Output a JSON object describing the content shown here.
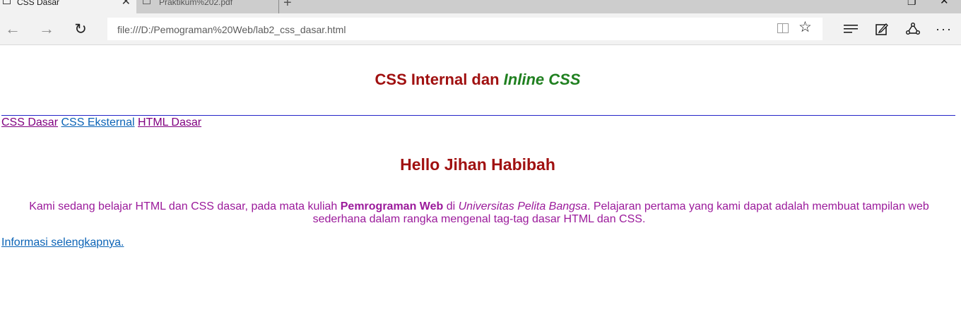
{
  "browser": {
    "tabs": [
      {
        "title": "CSS Dasar",
        "close": "✕"
      },
      {
        "title": "Praktikum%202.pdf"
      }
    ],
    "new_tab": "+",
    "window_controls": {
      "minimize": "—",
      "maximize": "❐",
      "close": "✕"
    },
    "toolbar": {
      "back_icon": "←",
      "forward_icon": "→",
      "refresh_icon": "↻",
      "url": "file:///D:/Pemograman%20Web/lab2_css_dasar.html",
      "favorite_icon": "☆",
      "more_icon": "···"
    }
  },
  "page": {
    "title_part1": "CSS Internal dan ",
    "title_part2": "Inline CSS",
    "nav_links": [
      "CSS Dasar",
      "CSS Eksternal",
      "HTML Dasar"
    ],
    "heading": "Hello Jihan Habibah",
    "paragraph": {
      "t1": "Kami sedang belajar HTML dan CSS dasar, pada mata kuliah ",
      "bold": "Pemrograman Web",
      "t2": " di ",
      "italic": "Universitas Pelita Bangsa",
      "t3": ". Pelajaran pertama yang kami dapat adalah membuat tampilan web sederhana dalam rangka mengenal tag-tag dasar HTML dan CSS."
    },
    "more_link": "Informasi selengkapnya."
  },
  "colors": {
    "heading": "#a01010",
    "inline_css": "#208020",
    "paragraph": "#9b1a9b",
    "visited_link": "#800080",
    "link": "#0b63b6",
    "rule": "#2424c8"
  }
}
